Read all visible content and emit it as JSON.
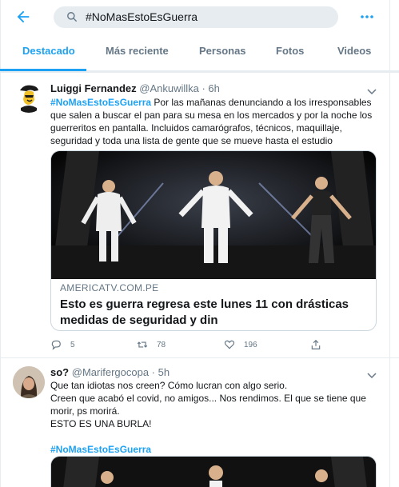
{
  "search": {
    "query": "#NoMasEstoEsGuerra"
  },
  "tabs": [
    {
      "label": "Destacado",
      "active": true
    },
    {
      "label": "Más reciente",
      "active": false
    },
    {
      "label": "Personas",
      "active": false
    },
    {
      "label": "Fotos",
      "active": false
    },
    {
      "label": "Videos",
      "active": false
    }
  ],
  "tweets": [
    {
      "name": "Luiggi Fernandez",
      "handle": "@Ankuwillka · 6h",
      "hashtag": "#NoMasEstoEsGuerra",
      "text": " Por las mañanas denunciando a los irresponsables que salen a buscar el pan para su mesa en los mercados y por la noche los guerreritos en pantalla. Incluidos camarógrafos, técnicos, maquillaje, seguridad y toda una lista de gente que se mueve hasta el estudio",
      "card": {
        "domain": "AMERICATV.COM.PE",
        "title": "Esto es guerra regresa este lunes 11 con drásticas medidas de seguridad y din"
      },
      "replies": "5",
      "retweets": "78",
      "likes": "196"
    },
    {
      "name": "so?",
      "handle": "@Marifergocopa · 5h",
      "lines": [
        "Que tan idiotas nos creen? Cómo lucran con algo serio.",
        "Creen que acabó el covid, no amigos... Nos rendimos. El que se tiene que morir, ps morirá.",
        "ESTO ES UNA BURLA!"
      ],
      "hashtag": "#NoMasEstoEsGuerra"
    }
  ],
  "colors": {
    "accent": "#1da1f2",
    "muted": "#657786",
    "border": "#e6ecf0"
  }
}
